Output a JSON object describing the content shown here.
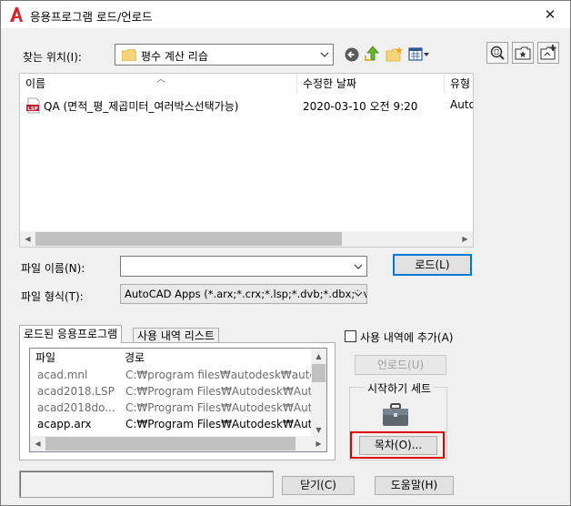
{
  "window": {
    "title": "응용프로그램 로드/언로드",
    "close_label": "✕"
  },
  "look_in": {
    "label": "찾는 위치(I):",
    "folder": "평수 계산 리습"
  },
  "file_list": {
    "columns": [
      "이름",
      "수정한 날짜",
      "유형"
    ],
    "rows": [
      {
        "name": "QA (면적_평_제곱미터_여러박스선택가능)",
        "modified": "2020-03-10 오전 9:20",
        "type": "Auto",
        "icon": "lsp-file-icon"
      }
    ]
  },
  "file_name": {
    "label": "파일 이름(N):",
    "value": ""
  },
  "file_type": {
    "label": "파일 형식(T):",
    "value": "AutoCAD Apps (*.arx;*.crx;*.lsp;*.dvb;*.dbx;*.v"
  },
  "load_button": "로드(L)",
  "tabs": {
    "loaded": "로드된 응용프로그램",
    "history": "사용 내역 리스트"
  },
  "loaded_apps": {
    "columns": [
      "파일",
      "경로"
    ],
    "rows": [
      {
        "file": "acad.mnl",
        "path": "C:₩program files₩autodesk₩auto..."
      },
      {
        "file": "acad2018.LSP",
        "path": "C:₩Program Files₩Autodesk₩Aut..."
      },
      {
        "file": "acad2018do...",
        "path": "C:₩Program Files₩Autodesk₩Aut..."
      },
      {
        "file": "acapp.arx",
        "path": "C:₩Program Files₩Autodesk₩Aut..."
      }
    ]
  },
  "add_to_history": "사용 내역에 추가(A)",
  "unload_button": "언로드(U)",
  "startup_suite": {
    "title": "시작하기 세트",
    "contents_button": "목차(O)..."
  },
  "close_button": "닫기(C)",
  "help_button": "도움말(H)"
}
